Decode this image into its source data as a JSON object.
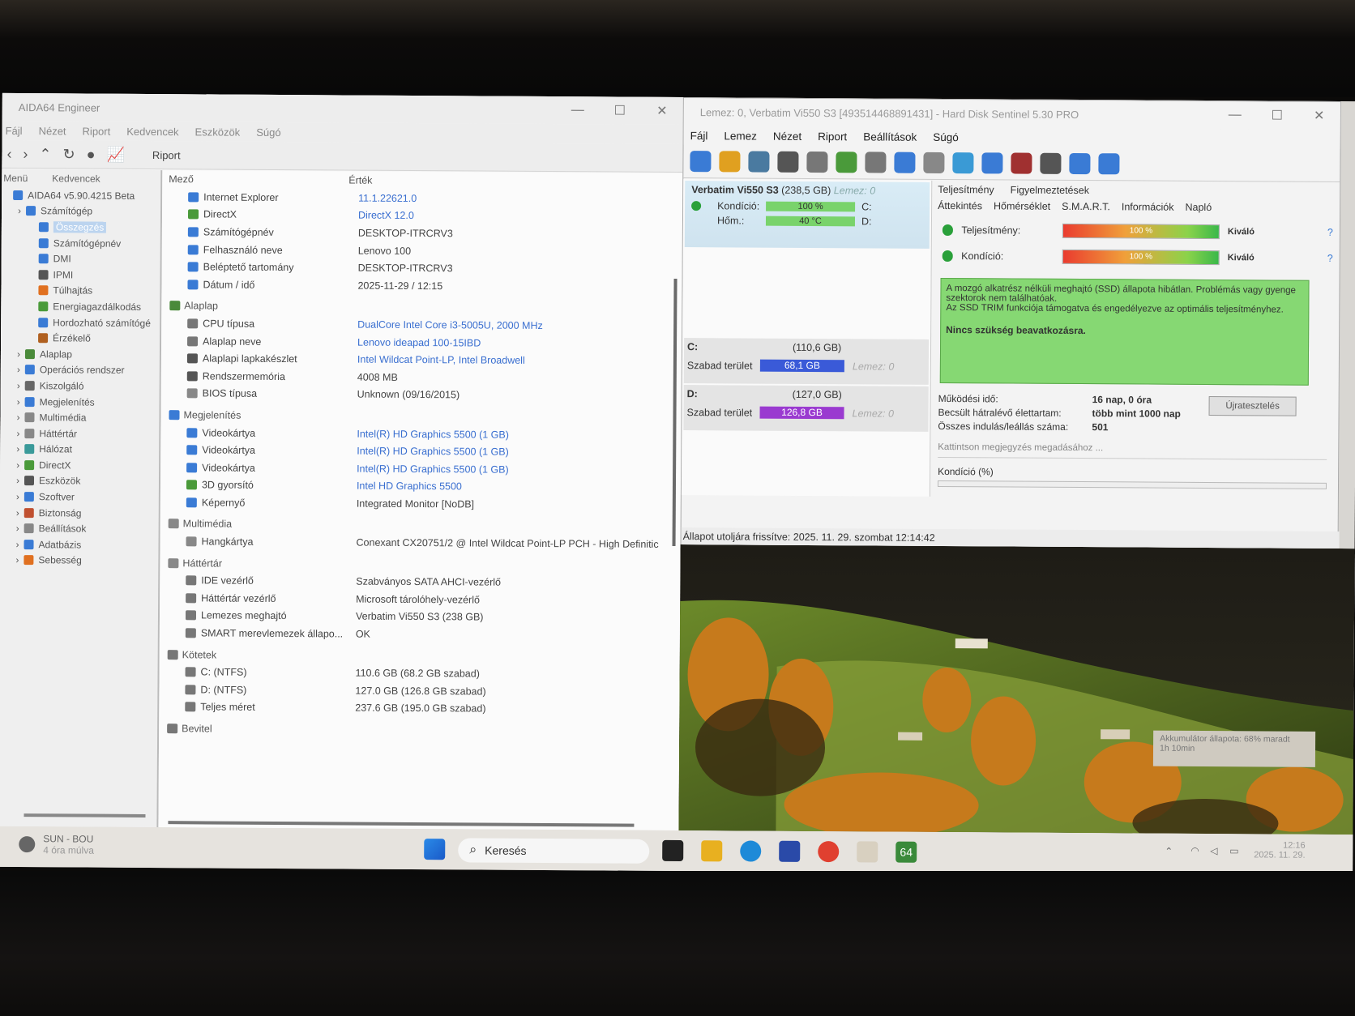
{
  "aida": {
    "title": "AIDA64 Engineer",
    "menu": [
      "Fájl",
      "Nézet",
      "Riport",
      "Kedvencek",
      "Eszközök",
      "Súgó"
    ],
    "toolbar_riport": "Riport",
    "tree_tabs": [
      "Menü",
      "Kedvencek"
    ],
    "tree": [
      {
        "label": "AIDA64 v5.90.4215 Beta",
        "indent": 0,
        "color": "#3a7bd5"
      },
      {
        "label": "Számítógép",
        "indent": 1,
        "color": "#3a7bd5"
      },
      {
        "label": "Összegzés",
        "indent": 2,
        "color": "#3a7bd5",
        "selected": true
      },
      {
        "label": "Számítógépnév",
        "indent": 2,
        "color": "#3a7bd5"
      },
      {
        "label": "DMI",
        "indent": 2,
        "color": "#3a7bd5"
      },
      {
        "label": "IPMI",
        "indent": 2,
        "color": "#555"
      },
      {
        "label": "Túlhajtás",
        "indent": 2,
        "color": "#e07020"
      },
      {
        "label": "Energiagazdálkodás",
        "indent": 2,
        "color": "#4a9a3a"
      },
      {
        "label": "Hordozható számítógé",
        "indent": 2,
        "color": "#3a7bd5"
      },
      {
        "label": "Érzékelő",
        "indent": 2,
        "color": "#b06020"
      },
      {
        "label": "Alaplap",
        "indent": 1,
        "color": "#4a8a3a"
      },
      {
        "label": "Operációs rendszer",
        "indent": 1,
        "color": "#3a7bd5"
      },
      {
        "label": "Kiszolgáló",
        "indent": 1,
        "color": "#666"
      },
      {
        "label": "Megjelenítés",
        "indent": 1,
        "color": "#3a7bd5"
      },
      {
        "label": "Multimédia",
        "indent": 1,
        "color": "#888"
      },
      {
        "label": "Háttértár",
        "indent": 1,
        "color": "#888"
      },
      {
        "label": "Hálózat",
        "indent": 1,
        "color": "#3a9a9a"
      },
      {
        "label": "DirectX",
        "indent": 1,
        "color": "#4a9a3a"
      },
      {
        "label": "Eszközök",
        "indent": 1,
        "color": "#555"
      },
      {
        "label": "Szoftver",
        "indent": 1,
        "color": "#3a7bd5"
      },
      {
        "label": "Biztonság",
        "indent": 1,
        "color": "#c05030"
      },
      {
        "label": "Beállítások",
        "indent": 1,
        "color": "#888"
      },
      {
        "label": "Adatbázis",
        "indent": 1,
        "color": "#3a7bd5"
      },
      {
        "label": "Sebesség",
        "indent": 1,
        "color": "#e07020"
      }
    ],
    "col_field": "Mező",
    "col_value": "Érték",
    "sections": [
      {
        "title": "",
        "icon_color": "",
        "rows": [
          {
            "f": "Internet Explorer",
            "v": "11.1.22621.0",
            "link": true,
            "c": "#3a7bd5"
          },
          {
            "f": "DirectX",
            "v": "DirectX 12.0",
            "link": true,
            "c": "#4a9a3a"
          },
          {
            "f": "Számítógépnév",
            "v": "DESKTOP-ITRCRV3",
            "link": false,
            "c": "#3a7bd5"
          },
          {
            "f": "Felhasználó neve",
            "v": "Lenovo 100",
            "link": false,
            "c": "#3a7bd5"
          },
          {
            "f": "Beléptető tartomány",
            "v": "DESKTOP-ITRCRV3",
            "link": false,
            "c": "#3a7bd5"
          },
          {
            "f": "Dátum / idő",
            "v": "2025-11-29 / 12:15",
            "link": false,
            "c": "#3a7bd5"
          }
        ]
      },
      {
        "title": "Alaplap",
        "icon_color": "#4a8a3a",
        "rows": [
          {
            "f": "CPU típusa",
            "v": "DualCore Intel Core i3-5005U, 2000 MHz",
            "link": true,
            "c": "#777"
          },
          {
            "f": "Alaplap neve",
            "v": "Lenovo ideapad 100-15IBD",
            "link": true,
            "c": "#777"
          },
          {
            "f": "Alaplapi lapkakészlet",
            "v": "Intel Wildcat Point-LP, Intel Broadwell",
            "link": true,
            "c": "#555"
          },
          {
            "f": "Rendszermemória",
            "v": "4008 MB",
            "link": false,
            "c": "#555"
          },
          {
            "f": "BIOS típusa",
            "v": "Unknown (09/16/2015)",
            "link": false,
            "c": "#888"
          }
        ]
      },
      {
        "title": "Megjelenítés",
        "icon_color": "#3a7bd5",
        "rows": [
          {
            "f": "Videokártya",
            "v": "Intel(R) HD Graphics 5500  (1 GB)",
            "link": true,
            "c": "#3a7bd5"
          },
          {
            "f": "Videokártya",
            "v": "Intel(R) HD Graphics 5500  (1 GB)",
            "link": true,
            "c": "#3a7bd5"
          },
          {
            "f": "Videokártya",
            "v": "Intel(R) HD Graphics 5500  (1 GB)",
            "link": true,
            "c": "#3a7bd5"
          },
          {
            "f": "3D gyorsító",
            "v": "Intel HD Graphics 5500",
            "link": true,
            "c": "#4a9a3a"
          },
          {
            "f": "Képernyő",
            "v": "Integrated Monitor [NoDB]",
            "link": false,
            "c": "#3a7bd5"
          }
        ]
      },
      {
        "title": "Multimédia",
        "icon_color": "#888",
        "rows": [
          {
            "f": "Hangkártya",
            "v": "Conexant CX20751/2 @ Intel Wildcat Point-LP PCH - High Definitic",
            "link": false,
            "c": "#888"
          }
        ]
      },
      {
        "title": "Háttértár",
        "icon_color": "#888",
        "rows": [
          {
            "f": "IDE vezérlő",
            "v": "Szabványos SATA AHCI-vezérlő",
            "link": false,
            "c": "#777"
          },
          {
            "f": "Háttértár vezérlő",
            "v": "Microsoft tárolóhely-vezérlő",
            "link": false,
            "c": "#777"
          },
          {
            "f": "Lemezes meghajtó",
            "v": "Verbatim Vi550 S3  (238 GB)",
            "link": false,
            "c": "#777"
          },
          {
            "f": "SMART merevlemezek állapo...",
            "v": "OK",
            "link": false,
            "c": "#777"
          }
        ]
      },
      {
        "title": "Kötetek",
        "icon_color": "#777",
        "rows": [
          {
            "f": "C: (NTFS)",
            "v": "110.6 GB (68.2 GB szabad)",
            "link": false,
            "c": "#777"
          },
          {
            "f": "D: (NTFS)",
            "v": "127.0 GB (126.8 GB szabad)",
            "link": false,
            "c": "#777"
          },
          {
            "f": "Teljes méret",
            "v": "237.6 GB (195.0 GB szabad)",
            "link": false,
            "c": "#777"
          }
        ]
      },
      {
        "title": "Bevitel",
        "icon_color": "#777",
        "rows": []
      }
    ]
  },
  "hds": {
    "title": "Lemez: 0, Verbatim Vi550 S3 [493514468891431] - Hard Disk Sentinel 5.30 PRO",
    "menu": [
      "Fájl",
      "Lemez",
      "Nézet",
      "Riport",
      "Beállítások",
      "Súgó"
    ],
    "tool_colors": [
      "#3a7bd5",
      "#e0a020",
      "#4a7aa0",
      "#555",
      "#777",
      "#4a9a3a",
      "#777",
      "#3a7bd5",
      "#888",
      "#3a9ad5",
      "#3a7bd5",
      "#a03030",
      "#555",
      "#3a7bd5",
      "#3a7bd5"
    ],
    "disk_name": "Verbatim Vi550 S3",
    "disk_size": "(238,5 GB)",
    "disk_lemez": "Lemez: 0",
    "kondicio_label": "Kondíció:",
    "kondicio_value": "100 %",
    "hom_label": "Hőm.:",
    "hom_value": "40 °C",
    "drive_c": "C:",
    "drive_d": "D:",
    "partitions": [
      {
        "drive": "C:",
        "size": "(110,6 GB)",
        "free_label": "Szabad terület",
        "free": "68,1 GB",
        "color": "#3a5ad8",
        "lemez": "Lemez: 0"
      },
      {
        "drive": "D:",
        "size": "(127,0 GB)",
        "free_label": "Szabad terület",
        "free": "126,8 GB",
        "color": "#9a3ad0",
        "lemez": "Lemez: 0"
      }
    ],
    "tabs_row1": [
      "Teljesítmény",
      "Figyelmeztetések"
    ],
    "tabs_row2": [
      "Áttekintés",
      "Hőmérséklet",
      "S.M.A.R.T.",
      "Információk",
      "Napló"
    ],
    "perf_label": "Teljesítmény:",
    "perf_value": "100 %",
    "perf_rating": "Kiváló",
    "cond_label": "Kondíció:",
    "cond_value": "100 %",
    "cond_rating": "Kiváló",
    "status_line1": "A mozgó alkatrész nélküli meghajtó (SSD) állapota hibátlan. Problémás vagy gyenge szektorok nem találhatóak.",
    "status_line2": "Az SSD TRIM funkciója támogatva és engedélyezve az optimális teljesítményhez.",
    "status_bold": "Nincs szükség beavatkozásra.",
    "uptime_label": "Működési idő:",
    "uptime_value": "16 nap, 0 óra",
    "life_label": "Becsült hátralévő élettartam:",
    "life_value": "több mint 1000 nap",
    "starts_label": "Összes indulás/leállás száma:",
    "starts_value": "501",
    "retest_button": "Újratesztelés",
    "note_placeholder": "Kattintson megjegyzés megadásához ...",
    "chart_label": "Kondíció  (%)",
    "statusbar": "Állapot utoljára frissítve: 2025. 11. 29. szombat 12:14:42"
  },
  "toast": {
    "line1": "Akkumulátor állapota: 68% maradt",
    "line2": "1h 10min"
  },
  "taskbar": {
    "weather_line1": "SUN - BOU",
    "weather_line2": "4 óra múlva",
    "search_placeholder": "Keresés",
    "aida_badge": "64",
    "time": "12:16",
    "date": "2025. 11. 29."
  }
}
